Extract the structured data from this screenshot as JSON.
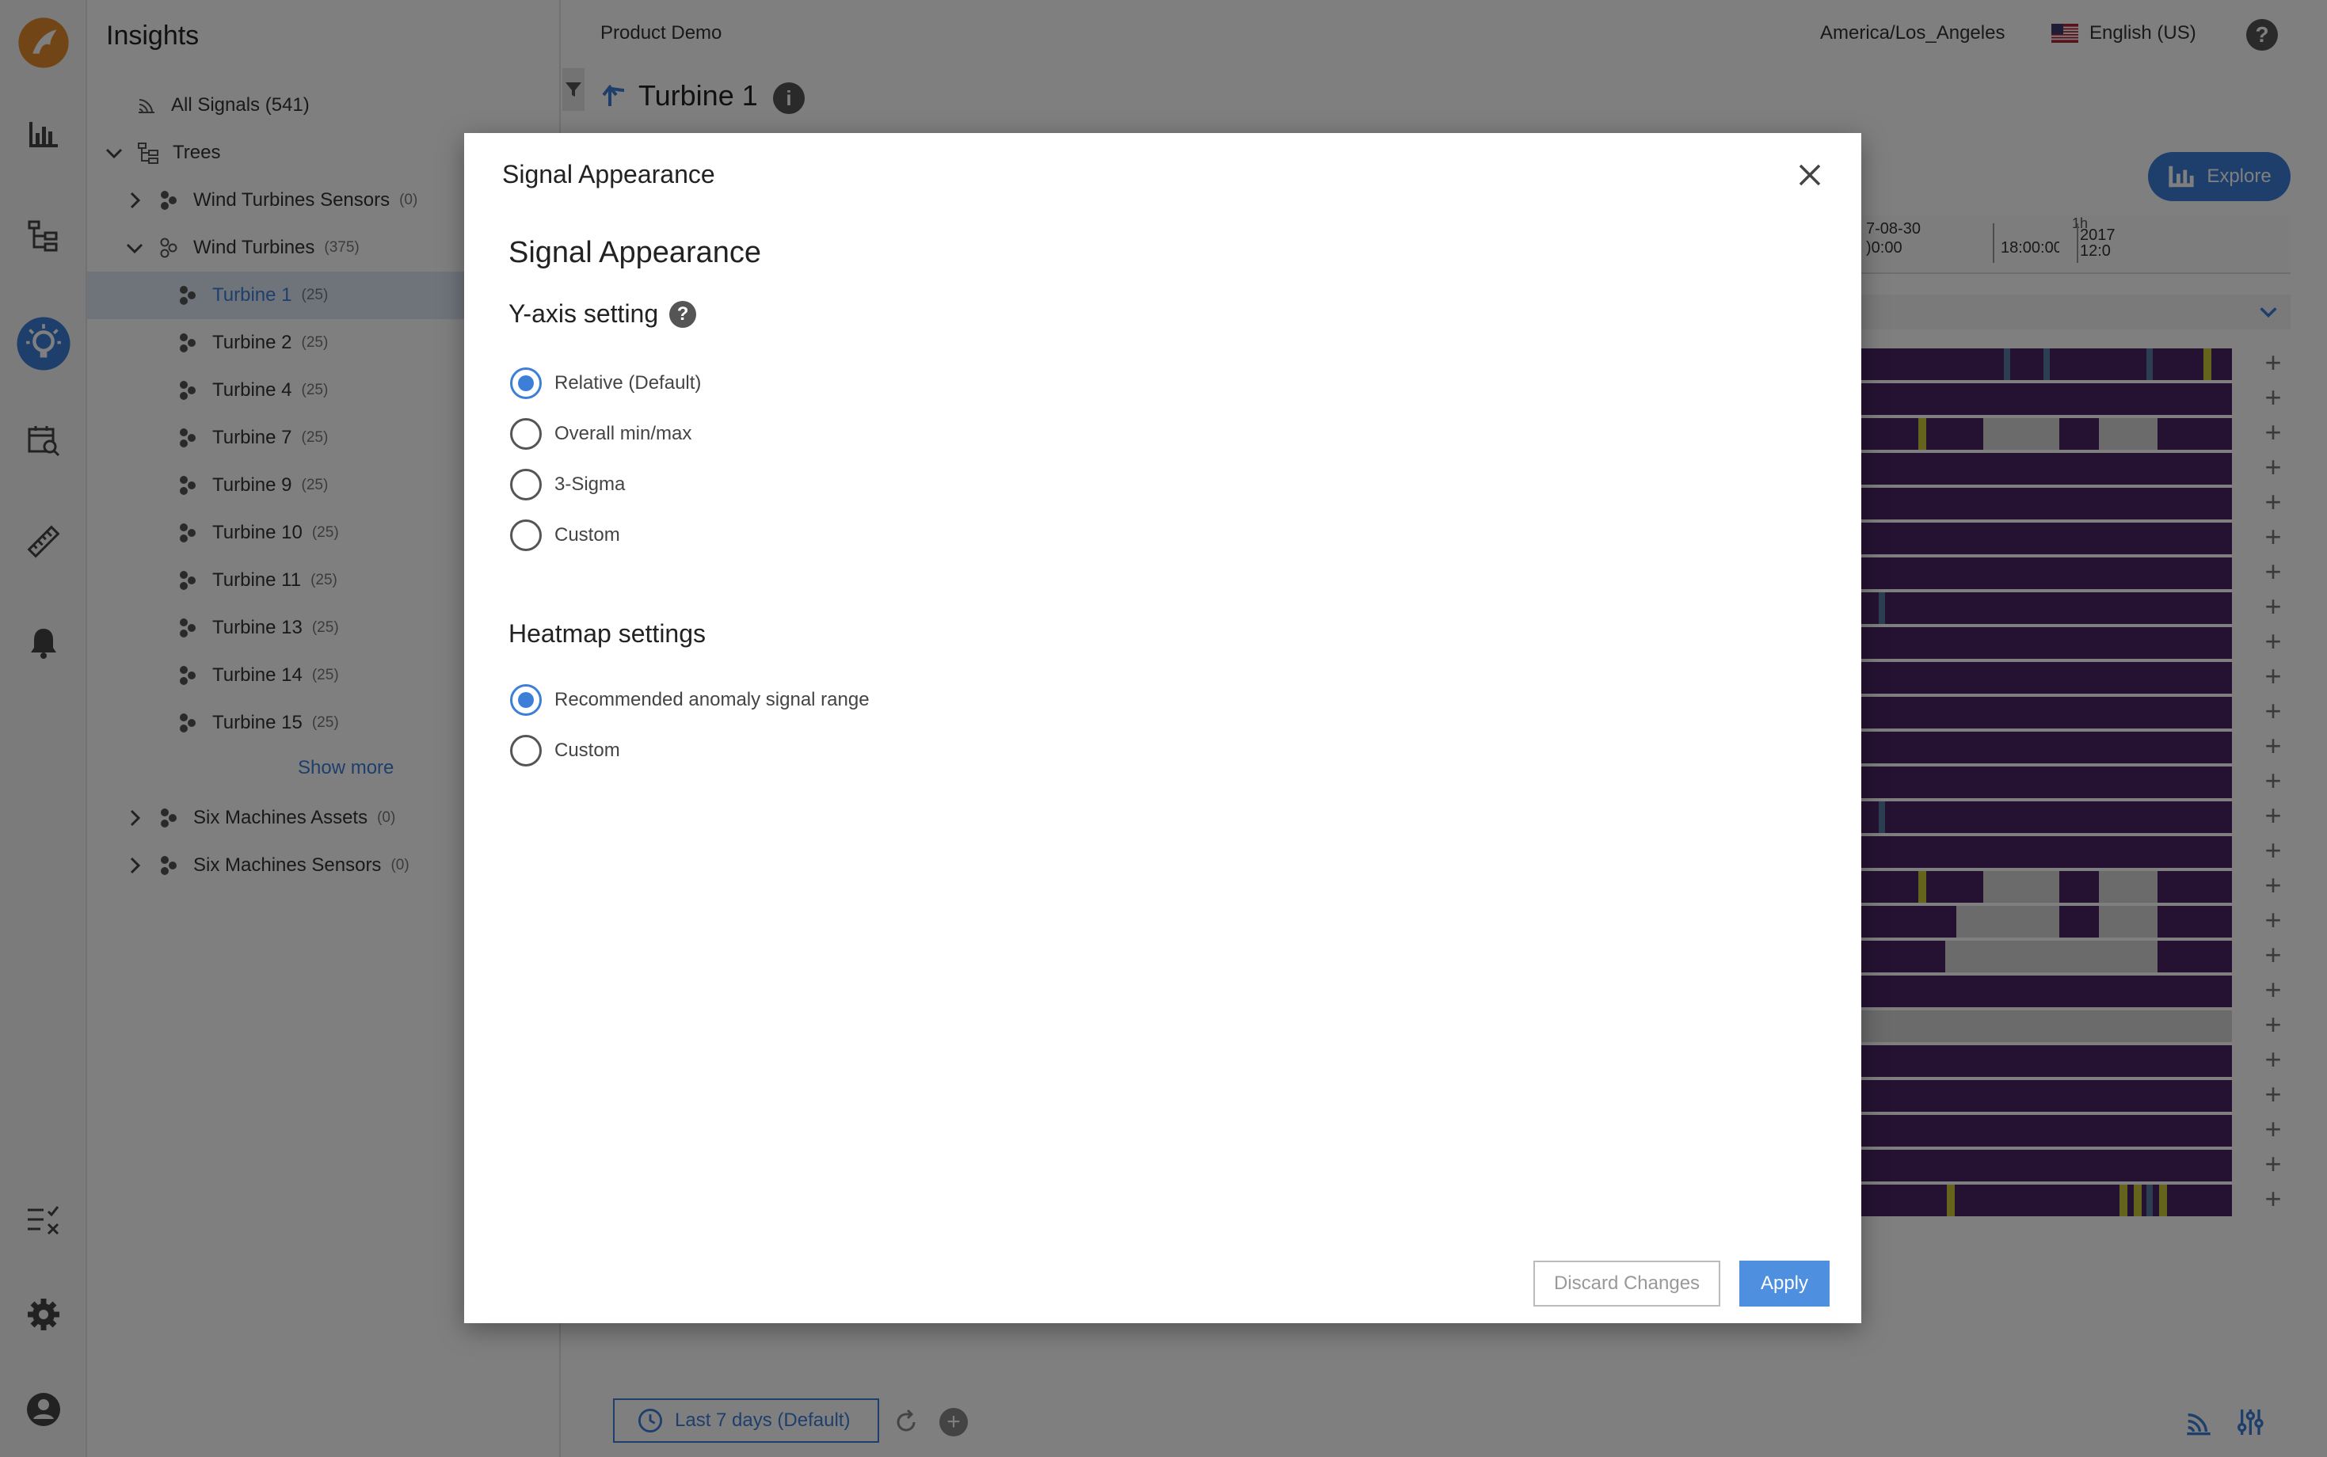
{
  "sidebar": {
    "title": "Insights",
    "all_signals": "All Signals (541)",
    "trees_label": "Trees",
    "items": [
      {
        "label": "Wind Turbines Sensors",
        "count": "(0)"
      },
      {
        "label": "Wind Turbines",
        "count": "(375)"
      },
      {
        "label": "Turbine 1",
        "count": "(25)"
      },
      {
        "label": "Turbine 2",
        "count": "(25)"
      },
      {
        "label": "Turbine 4",
        "count": "(25)"
      },
      {
        "label": "Turbine 7",
        "count": "(25)"
      },
      {
        "label": "Turbine 9",
        "count": "(25)"
      },
      {
        "label": "Turbine 10",
        "count": "(25)"
      },
      {
        "label": "Turbine 11",
        "count": "(25)"
      },
      {
        "label": "Turbine 13",
        "count": "(25)"
      },
      {
        "label": "Turbine 14",
        "count": "(25)"
      },
      {
        "label": "Turbine 15",
        "count": "(25)"
      },
      {
        "label": "Six Machines Assets",
        "count": "(0)"
      },
      {
        "label": "Six Machines Sensors",
        "count": "(0)"
      }
    ],
    "show_more": "Show more"
  },
  "topbar": {
    "workspace": "Product Demo",
    "timezone": "America/Los_Angeles",
    "language": "English (US)"
  },
  "main": {
    "asset_title": "Turbine 1",
    "explore_label": "Explore",
    "timeline": {
      "date_label": "7-08-30",
      "time_left": ")0:00",
      "time_mid": "18:00:00",
      "res_label": "1h",
      "year_right": "2017",
      "time_right": "12:0"
    },
    "time_range": "Last 7 days (Default)"
  },
  "modal": {
    "header_title": "Signal Appearance",
    "heading": "Signal Appearance",
    "yaxis_title": "Y-axis setting",
    "yaxis_options": [
      "Relative (Default)",
      "Overall min/max",
      "3-Sigma",
      "Custom"
    ],
    "yaxis_selected": "Relative (Default)",
    "heatmap_title": "Heatmap settings",
    "heatmap_options": [
      "Recommended anomaly signal range",
      "Custom"
    ],
    "heatmap_selected": "Recommended anomaly signal range",
    "discard_label": "Discard Changes",
    "apply_label": "Apply"
  },
  "colors": {
    "accent": "#3d7fd8",
    "heatmap_purple": "#4b2466",
    "logo_orange": "#e38b2c"
  }
}
